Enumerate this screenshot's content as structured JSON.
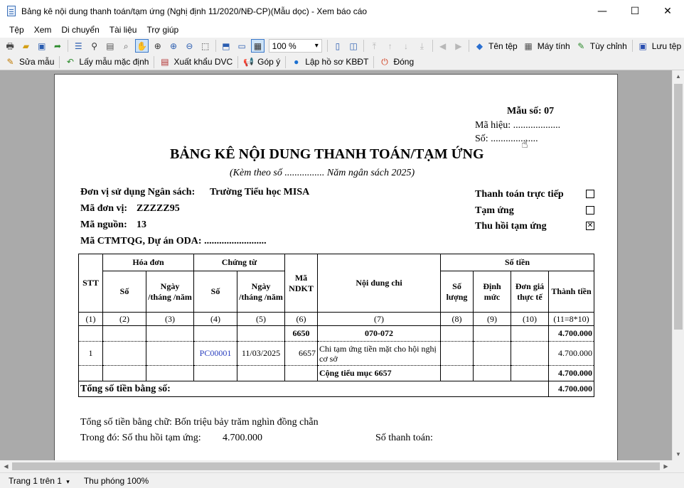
{
  "window": {
    "title": "Bảng kê nội dung thanh toán/tạm ứng (Nghị định 11/2020/NĐ-CP)(Mẫu dọc) - Xem báo cáo",
    "min_glyph": "—",
    "max_glyph": "☐",
    "close_glyph": "✕"
  },
  "menu": [
    "Tệp",
    "Xem",
    "Di chuyển",
    "Tài liệu",
    "Trợ giúp"
  ],
  "toolbar1": {
    "zoom_value": "100 %",
    "zoom_arrow": "▾",
    "filename_label": "Tên tệp",
    "calculator_label": "Máy tính",
    "customize_label": "Tùy chỉnh",
    "save_label": "Lưu tệp"
  },
  "toolbar2": {
    "edit_template": "Sửa mẫu",
    "default_template": "Lấy mẫu mặc định",
    "export_dvc": "Xuất khẩu DVC",
    "feedback": "Góp ý",
    "kbdt": "Lập hồ sơ KBĐT",
    "close": "Đóng"
  },
  "status": {
    "page": "Trang 1 trên 1",
    "page_arrow": "▾",
    "zoom": "Thu phóng 100%"
  },
  "report": {
    "form_no": "Mẫu số: 07",
    "code": "Mã hiệu: ...................",
    "number": "Số: ...................",
    "title": "BẢNG KÊ NỘI DUNG THANH TOÁN/TẠM ỨNG",
    "subtitle": "(Kèm theo  số ................ Năm ngân sách 2025)",
    "unit_label": "Đơn vị sử dụng Ngân sách:",
    "unit_value": "Trường Tiểu học MISA",
    "unit_code_label": "Mã đơn vị:",
    "unit_code_value": "ZZZZZ95",
    "source_label": "Mã nguồn:",
    "source_value": "13",
    "oda_label": "Mã CTMTQG, Dự án ODA: .........................",
    "checks": [
      {
        "label": "Thanh toán trực tiếp",
        "mark": ""
      },
      {
        "label": "Tạm ứng",
        "mark": ""
      },
      {
        "label": "Thu hồi tạm ứng",
        "mark": "✕"
      }
    ],
    "table": {
      "h_stt": "STT",
      "h_invoice": "Hóa đơn",
      "h_voucher": "Chứng từ",
      "h_ndkt": "Mã NDKT",
      "h_content": "Nội dung chi",
      "h_amount": "Số tiền",
      "h_no": "Số",
      "h_date": "Ngày /tháng /năm",
      "h_qty": "Số lượng",
      "h_norm": "Định mức",
      "h_price": "Đơn giá thực tế",
      "h_total": "Thành tiền",
      "idx": [
        "(1)",
        "(2)",
        "(3)",
        "(4)",
        "(5)",
        "(6)",
        "(7)",
        "(8)",
        "(9)",
        "(10)",
        "(11=8*10)"
      ],
      "group_row": {
        "ndkt": "6650",
        "content": "070-072",
        "total": "4.700.000"
      },
      "row1": {
        "stt": "1",
        "voucher_no": "PC00001",
        "voucher_date": "11/03/2025",
        "ndkt": "6657",
        "content": "Chi tạm ứng tiền mặt cho hội nghị cơ sở",
        "total": "4.700.000"
      },
      "subtotal": {
        "label": "Cộng tiểu mục 6657",
        "total": "4.700.000"
      },
      "grand": {
        "label": "Tổng số tiền bằng số:",
        "total": "4.700.000"
      }
    },
    "words_label": "Tổng số tiền bằng chữ: Bốn triệu bảy trăm nghìn đồng chẵn",
    "recovery_label": "Trong đó:  Số thu hồi tạm ứng:",
    "recovery_value": "4.700.000",
    "payment_label": "Số thanh toán:"
  }
}
